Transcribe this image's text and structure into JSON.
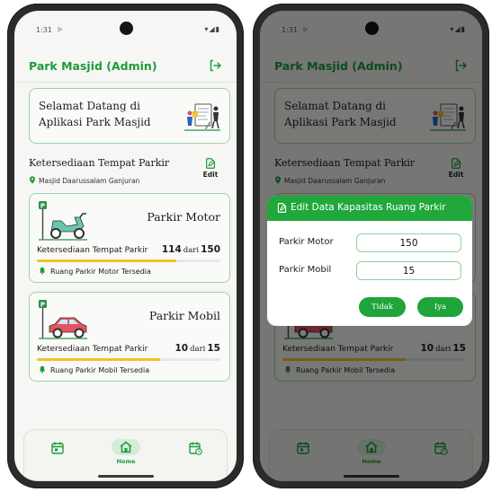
{
  "status": {
    "time": "1:31",
    "play_glyph": "ᐅ",
    "icons": "▾◢▮"
  },
  "app": {
    "title": "Park Masjid (Admin)",
    "logout_icon": "logout-icon"
  },
  "welcome": {
    "line1": "Selamat Datang di",
    "line2": "Aplikasi Park Masjid"
  },
  "section": {
    "title": "Ketersediaan Tempat Parkir",
    "edit_label": "Edit",
    "location": "Masjid Daarussalam Ganjuran"
  },
  "cards": {
    "motor": {
      "title": "Parkir Motor",
      "cap_label": "Ketersediaan Tempat Parkir",
      "available": "114",
      "dari": "dari",
      "total": "150",
      "fill": 0.76,
      "status": "Ruang Parkir Motor Tersedia"
    },
    "mobil": {
      "title": "Parkir Mobil",
      "cap_label": "Ketersediaan Tempat Parkir",
      "available": "10",
      "dari": "dari",
      "total": "15",
      "fill": 0.67,
      "status": "Ruang Parkir Mobil Tersedia"
    }
  },
  "nav": {
    "home_label": "Home"
  },
  "dialog": {
    "title": "Edit Data Kapasitas Ruang Parkir",
    "motor_label": "Parkir Motor",
    "motor_value": "150",
    "mobil_label": "Parkir Mobil",
    "mobil_value": "15",
    "btn_tidak": "Tidak",
    "btn_iya": "Iya"
  },
  "colors": {
    "accent": "#1e9b3a",
    "border": "#9fd3a6",
    "progress": "#f4c22b",
    "dialog_header": "#20a83c"
  }
}
